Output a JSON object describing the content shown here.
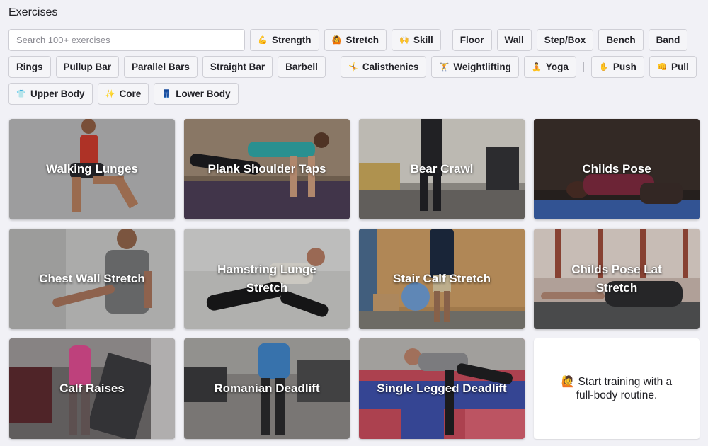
{
  "page": {
    "title": "Exercises"
  },
  "search": {
    "placeholder": "Search 100+ exercises",
    "value": ""
  },
  "filters": {
    "type": [
      {
        "label": "Strength",
        "icon": "flexed-biceps-icon",
        "glyph": "💪"
      },
      {
        "label": "Stretch",
        "icon": "person-stretching-icon",
        "glyph": "🙆"
      },
      {
        "label": "Skill",
        "icon": "raised-hands-icon",
        "glyph": "🙌"
      }
    ],
    "equipment": [
      "Floor",
      "Wall",
      "Step/Box",
      "Bench",
      "Band",
      "Rings",
      "Pullup Bar",
      "Parallel Bars",
      "Straight Bar",
      "Barbell"
    ],
    "discipline": [
      {
        "label": "Calisthenics",
        "icon": "cartwheel-icon",
        "glyph": "🤸"
      },
      {
        "label": "Weightlifting",
        "icon": "weightlifter-icon",
        "glyph": "🏋"
      },
      {
        "label": "Yoga",
        "icon": "lotus-position-icon",
        "glyph": "🧘"
      }
    ],
    "movement": [
      {
        "label": "Push",
        "icon": "raised-hand-icon",
        "glyph": "✋"
      },
      {
        "label": "Pull",
        "icon": "fist-icon",
        "glyph": "👊"
      }
    ],
    "body": [
      {
        "label": "Upper Body",
        "icon": "shirt-icon",
        "glyph": "👕"
      },
      {
        "label": "Core",
        "icon": "core-icon",
        "glyph": "✨"
      },
      {
        "label": "Lower Body",
        "icon": "jeans-icon",
        "glyph": "👖"
      }
    ]
  },
  "exercises": [
    {
      "name": "Walking Lunges"
    },
    {
      "name": "Plank Shoulder Taps"
    },
    {
      "name": "Bear Crawl"
    },
    {
      "name": "Childs Pose"
    },
    {
      "name": "Chest Wall Stretch"
    },
    {
      "name": "Hamstring Lunge Stretch"
    },
    {
      "name": "Stair Calf Stretch"
    },
    {
      "name": "Childs Pose Lat Stretch"
    },
    {
      "name": "Calf Raises"
    },
    {
      "name": "Romanian Deadlift"
    },
    {
      "name": "Single Legged Deadlift"
    }
  ],
  "promo": {
    "text": "🙋 Start training with a full-body routine."
  },
  "colors": {
    "background": "#f1f1f6",
    "chip_border": "#cfcfd6",
    "card_text": "#ffffff"
  }
}
